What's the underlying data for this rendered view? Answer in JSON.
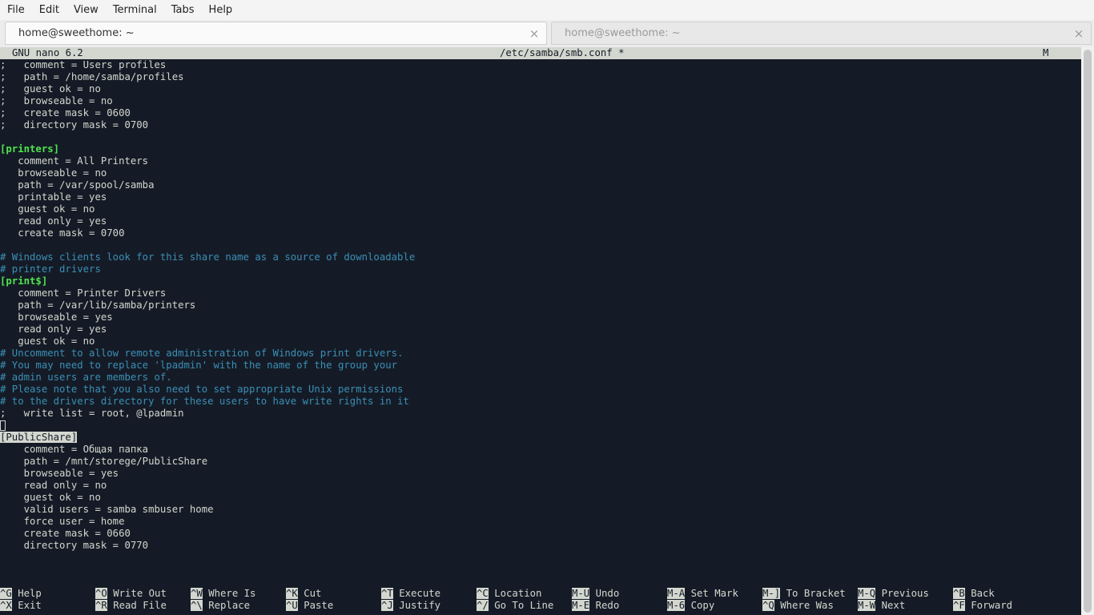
{
  "menubar": {
    "items": [
      "File",
      "Edit",
      "View",
      "Terminal",
      "Tabs",
      "Help"
    ]
  },
  "tabs": [
    {
      "label": "home@sweethome: ~",
      "close": "×"
    },
    {
      "label": "home@sweethome: ~",
      "close": "×"
    }
  ],
  "nano": {
    "version": "GNU nano 6.2",
    "filename": "/etc/samba/smb.conf *",
    "mode": "M"
  },
  "file_lines": [
    {
      "text": ";   comment = Users profiles",
      "kind": "normal"
    },
    {
      "text": ";   path = /home/samba/profiles",
      "kind": "normal"
    },
    {
      "text": ";   guest ok = no",
      "kind": "normal"
    },
    {
      "text": ";   browseable = no",
      "kind": "normal"
    },
    {
      "text": ";   create mask = 0600",
      "kind": "normal"
    },
    {
      "text": ";   directory mask = 0700",
      "kind": "normal"
    },
    {
      "text": "",
      "kind": "normal"
    },
    {
      "text": "[printers]",
      "kind": "section"
    },
    {
      "text": "   comment = All Printers",
      "kind": "normal"
    },
    {
      "text": "   browseable = no",
      "kind": "normal"
    },
    {
      "text": "   path = /var/spool/samba",
      "kind": "normal"
    },
    {
      "text": "   printable = yes",
      "kind": "normal"
    },
    {
      "text": "   guest ok = no",
      "kind": "normal"
    },
    {
      "text": "   read only = yes",
      "kind": "normal"
    },
    {
      "text": "   create mask = 0700",
      "kind": "normal"
    },
    {
      "text": "",
      "kind": "normal"
    },
    {
      "text": "# Windows clients look for this share name as a source of downloadable",
      "kind": "comment"
    },
    {
      "text": "# printer drivers",
      "kind": "comment"
    },
    {
      "text": "[print$]",
      "kind": "section"
    },
    {
      "text": "   comment = Printer Drivers",
      "kind": "normal"
    },
    {
      "text": "   path = /var/lib/samba/printers",
      "kind": "normal"
    },
    {
      "text": "   browseable = yes",
      "kind": "normal"
    },
    {
      "text": "   read only = yes",
      "kind": "normal"
    },
    {
      "text": "   guest ok = no",
      "kind": "normal"
    },
    {
      "text": "# Uncomment to allow remote administration of Windows print drivers.",
      "kind": "comment"
    },
    {
      "text": "# You may need to replace 'lpadmin' with the name of the group your",
      "kind": "comment"
    },
    {
      "text": "# admin users are members of.",
      "kind": "comment"
    },
    {
      "text": "# Please note that you also need to set appropriate Unix permissions",
      "kind": "comment"
    },
    {
      "text": "# to the drivers directory for these users to have write rights in it",
      "kind": "comment"
    },
    {
      "text": ";   write list = root, @lpadmin",
      "kind": "normal"
    },
    {
      "text": "",
      "kind": "cursor"
    },
    {
      "text": "[PublicShare]",
      "kind": "highlight"
    },
    {
      "text": "    comment = Общая папка",
      "kind": "normal"
    },
    {
      "text": "    path = /mnt/storege/PublicShare",
      "kind": "normal"
    },
    {
      "text": "    browseable = yes",
      "kind": "normal"
    },
    {
      "text": "    read only = no",
      "kind": "normal"
    },
    {
      "text": "    guest ok = no",
      "kind": "normal"
    },
    {
      "text": "    valid users = samba smbuser home",
      "kind": "normal"
    },
    {
      "text": "    force user = home",
      "kind": "normal"
    },
    {
      "text": "    create mask = 0660",
      "kind": "normal"
    },
    {
      "text": "    directory mask = 0770",
      "kind": "normal"
    }
  ],
  "shortcuts": [
    {
      "key": "^G",
      "label": "Help"
    },
    {
      "key": "^X",
      "label": "Exit"
    },
    {
      "key": "^O",
      "label": "Write Out"
    },
    {
      "key": "^R",
      "label": "Read File"
    },
    {
      "key": "^W",
      "label": "Where Is"
    },
    {
      "key": "^\\",
      "label": "Replace"
    },
    {
      "key": "^K",
      "label": "Cut"
    },
    {
      "key": "^U",
      "label": "Paste"
    },
    {
      "key": "^T",
      "label": "Execute"
    },
    {
      "key": "^J",
      "label": "Justify"
    },
    {
      "key": "^C",
      "label": "Location"
    },
    {
      "key": "^/",
      "label": "Go To Line"
    },
    {
      "key": "M-U",
      "label": "Undo"
    },
    {
      "key": "M-E",
      "label": "Redo"
    },
    {
      "key": "M-A",
      "label": "Set Mark"
    },
    {
      "key": "M-6",
      "label": "Copy"
    },
    {
      "key": "M-]",
      "label": "To Bracket"
    },
    {
      "key": "^Q",
      "label": "Where Was"
    },
    {
      "key": "M-Q",
      "label": "Previous"
    },
    {
      "key": "M-W",
      "label": "Next"
    },
    {
      "key": "^B",
      "label": "Back"
    },
    {
      "key": "^F",
      "label": "Forward"
    }
  ]
}
